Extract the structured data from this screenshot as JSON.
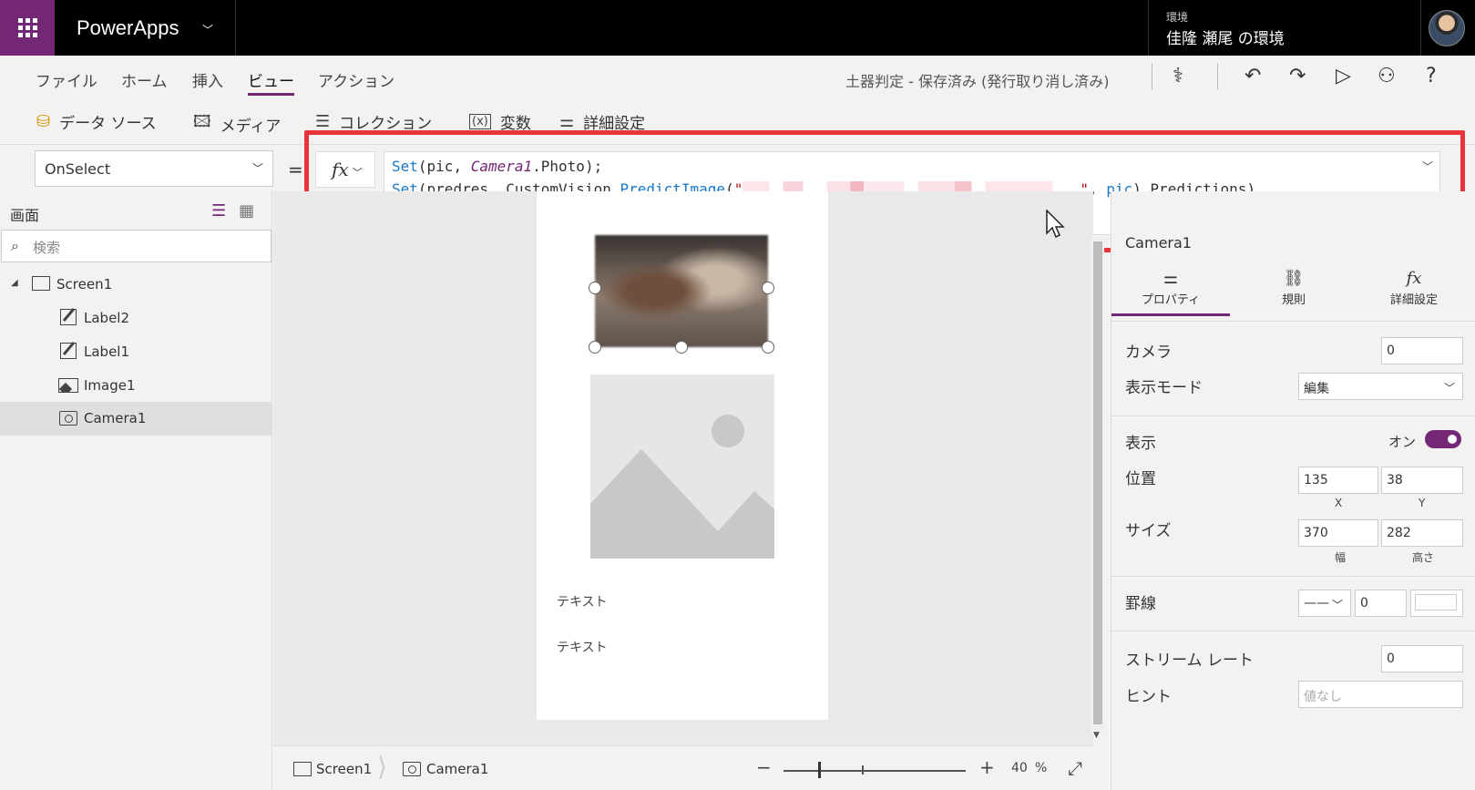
{
  "topbar": {
    "app_name": "PowerApps",
    "env_label": "環境",
    "env_name": "佳隆 瀬尾 の環境"
  },
  "menu": {
    "items": [
      "ファイル",
      "ホーム",
      "挿入",
      "ビュー",
      "アクション"
    ],
    "active": "ビュー",
    "save_status": "土器判定 - 保存済み (発行取り消し済み)"
  },
  "ribbon": {
    "items": [
      "データ ソース",
      "メディア",
      "コレクション",
      "変数",
      "詳細設定"
    ]
  },
  "formula": {
    "property": "OnSelect",
    "equals": "=",
    "fx_label": "fx",
    "line1": {
      "fn1": "Set",
      "part1": "(pic, ",
      "ctrl": "Camera1",
      "part2": ".Photo);"
    },
    "line2": {
      "fn1": "Set",
      "part1": "(predres, CustomVision.",
      "fn2": "PredictImage",
      "part2": "(",
      "str_open": "\"",
      "str_close": "\"",
      "part3": ", ",
      "var": "pic",
      "part4": ").Predictions)"
    },
    "help": "?"
  },
  "tree": {
    "title": "画面",
    "search_placeholder": "検索",
    "items": [
      "Screen1",
      "Label2",
      "Label1",
      "Image1",
      "Camera1"
    ],
    "selected": "Camera1"
  },
  "canvas": {
    "text1": "テキスト",
    "text2": "テキスト"
  },
  "bottombar": {
    "breadcrumb_screen": "Screen1",
    "breadcrumb_control": "Camera1",
    "zoom_minus": "−",
    "zoom_plus": "+",
    "zoom_value": "40",
    "zoom_unit": "%"
  },
  "properties": {
    "control_name": "Camera1",
    "tabs": [
      "プロパティ",
      "規則",
      "詳細設定"
    ],
    "camera_label": "カメラ",
    "camera_value": "0",
    "display_mode_label": "表示モード",
    "display_mode_value": "編集",
    "visible_label": "表示",
    "visible_value": "オン",
    "position_label": "位置",
    "x_value": "135",
    "x_label": "X",
    "y_value": "38",
    "y_label": "Y",
    "size_label": "サイズ",
    "width_value": "370",
    "width_label": "幅",
    "height_value": "282",
    "height_label": "高さ",
    "border_label": "罫線",
    "border_style": "——",
    "border_width": "0",
    "stream_rate_label": "ストリーム レート",
    "stream_rate_value": "0",
    "hint_label": "ヒント",
    "hint_placeholder": "値なし"
  },
  "colors": {
    "accent": "#742774",
    "highlight_frame": "#e8343a",
    "keyword": "#1879c9"
  }
}
